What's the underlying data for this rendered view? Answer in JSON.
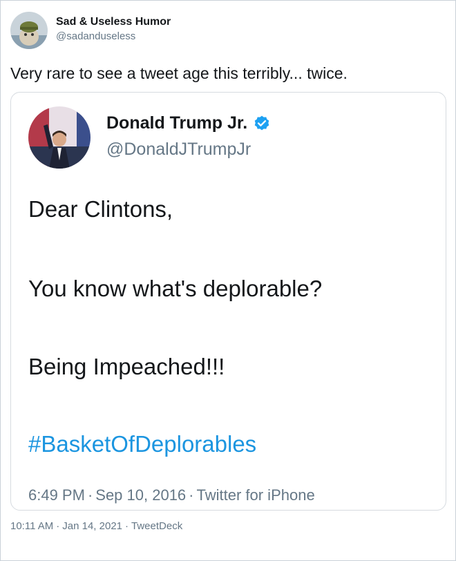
{
  "tweet": {
    "author_name": "Sad & Useless Humor",
    "author_handle": "@sadanduseless",
    "text": "Very rare to see a tweet age this terribly... twice.",
    "time": "10:11 AM",
    "date": "Jan 14, 2021",
    "source": "TweetDeck",
    "separator": "·"
  },
  "quoted_tweet": {
    "author_name": "Donald Trump Jr.",
    "author_handle": "@DonaldJTrumpJr",
    "line1": "Dear Clintons,",
    "line2": "You know what's deplorable?",
    "line3": "Being Impeached!!!",
    "hashtag": "#BasketOfDeplorables",
    "time": "6:49 PM",
    "date": "Sep 10, 2016",
    "source": "Twitter for iPhone",
    "separator": "·",
    "verified_icon": "verified-badge-icon"
  },
  "colors": {
    "link_blue": "#1b95e0",
    "secondary_text": "#657786",
    "verified_blue": "#1da1f2"
  }
}
